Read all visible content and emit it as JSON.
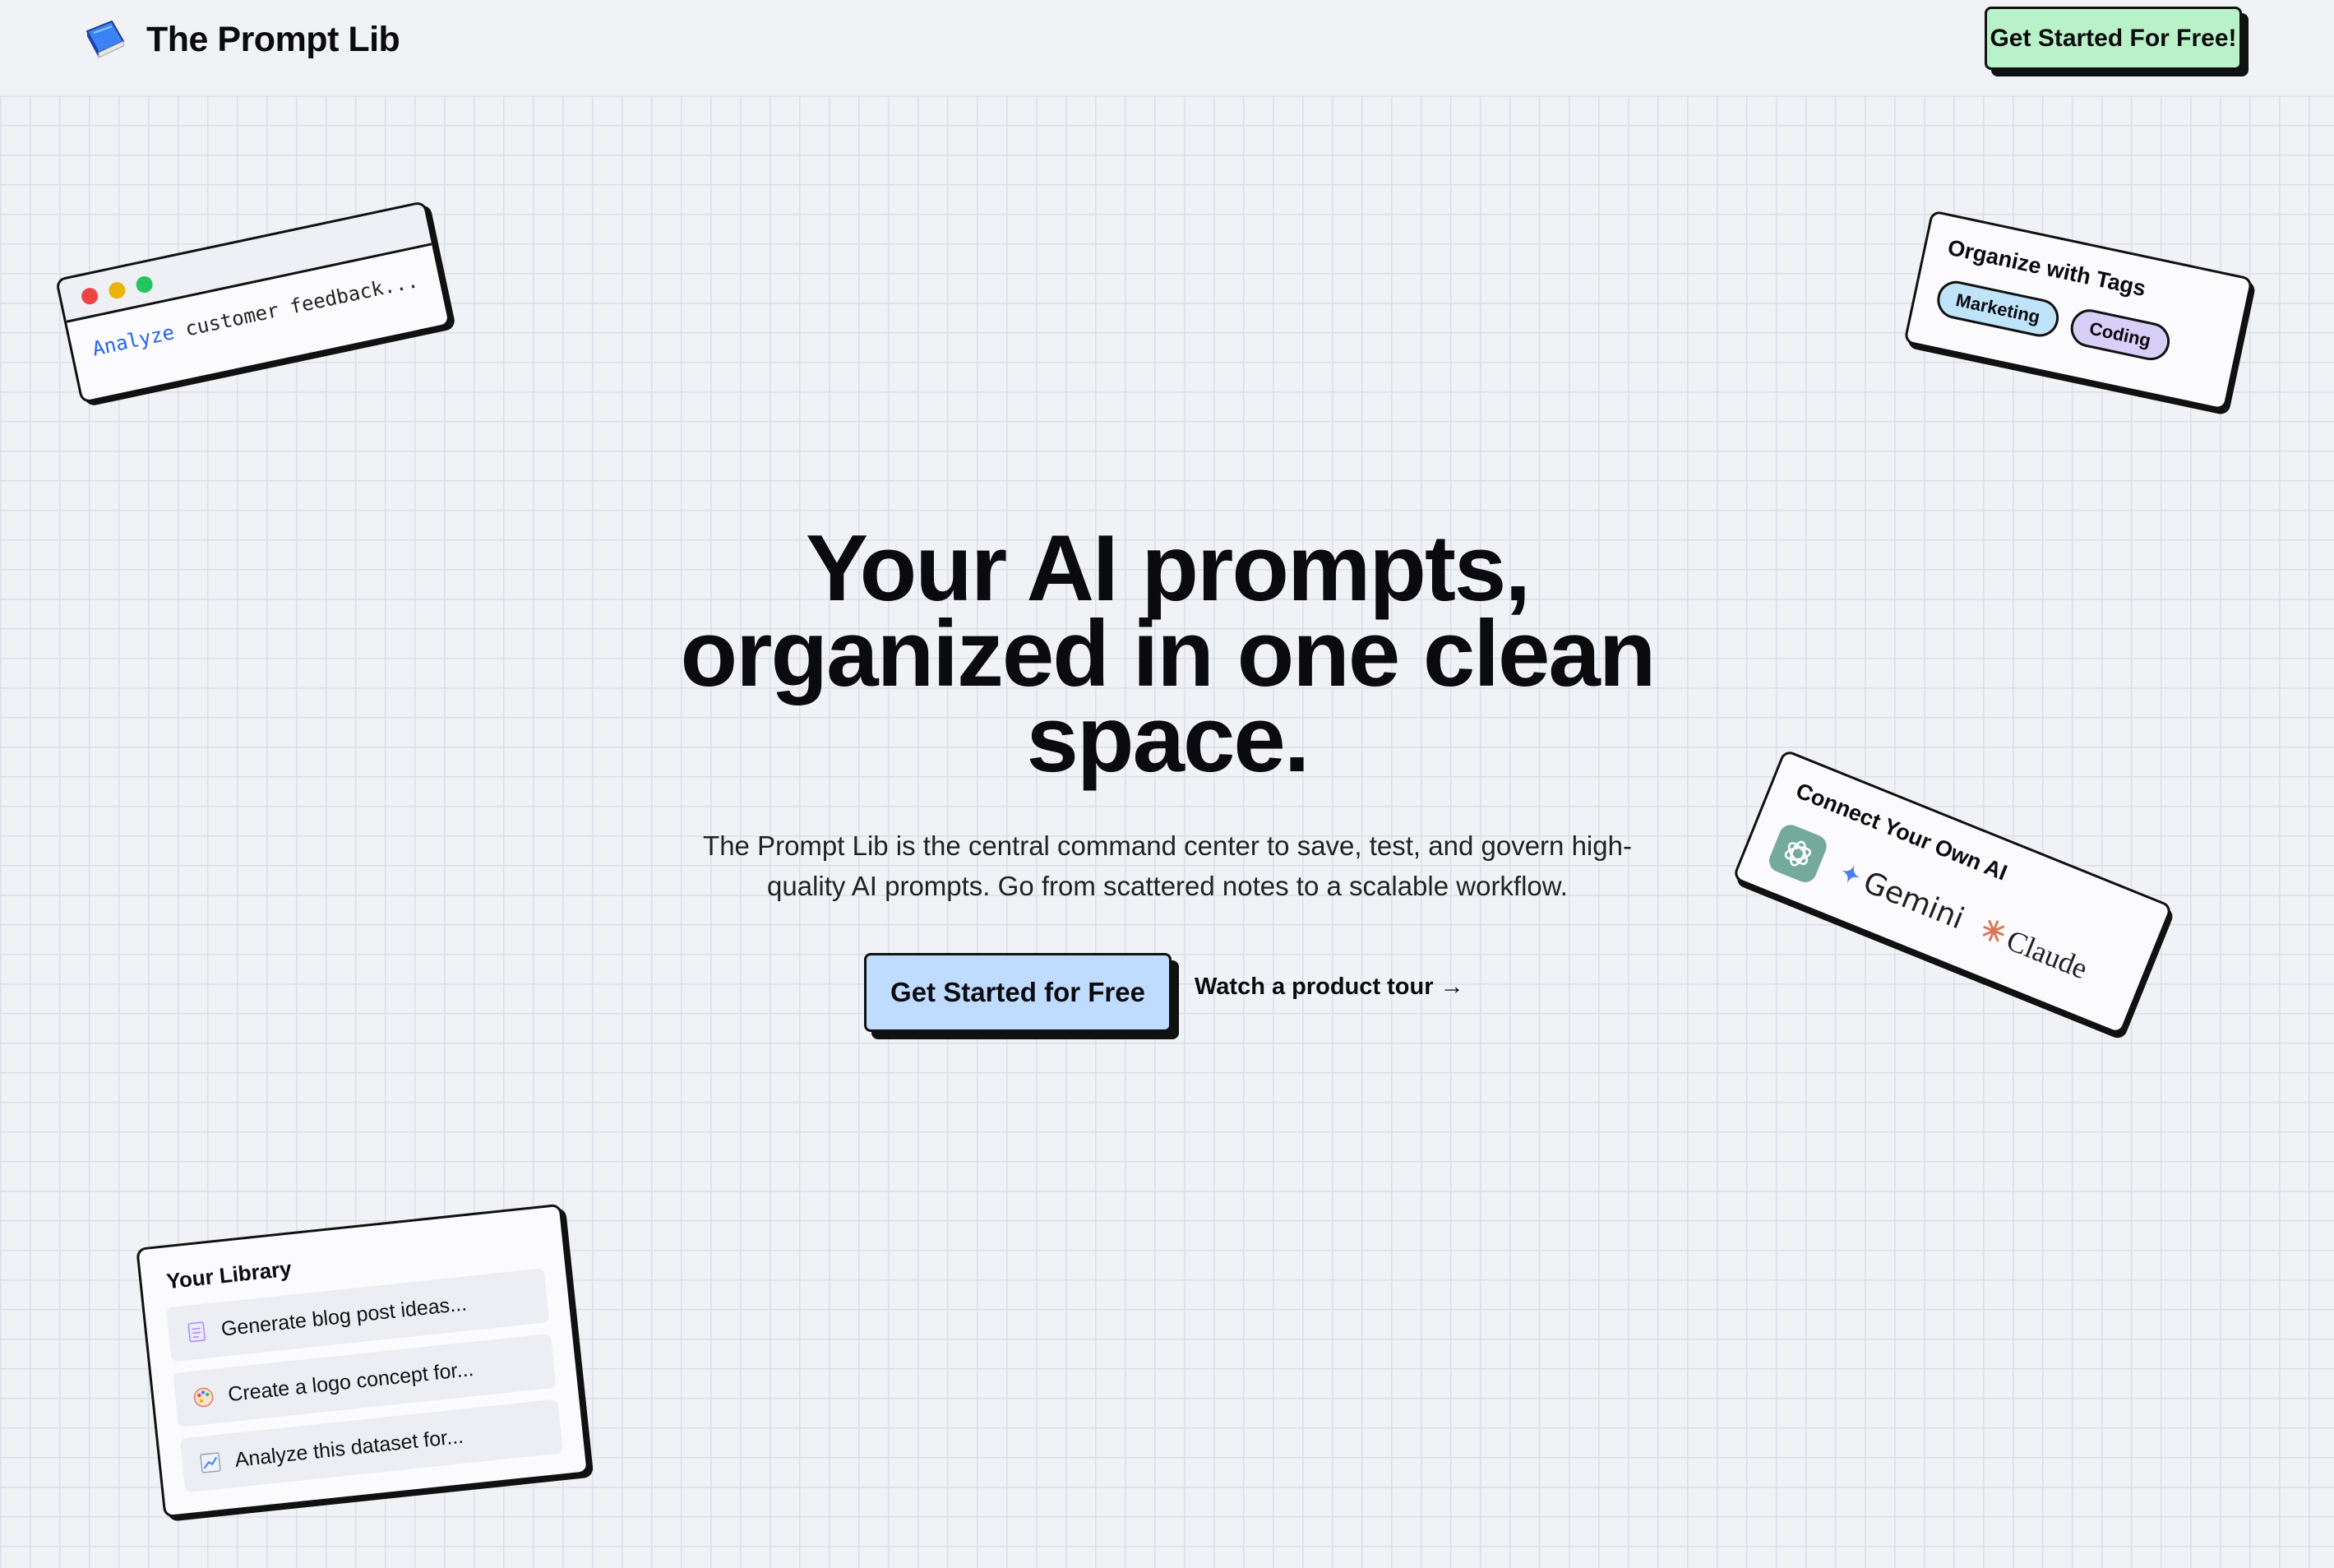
{
  "header": {
    "brand_title": "The Prompt Lib",
    "cta_label": "Get Started For Free!"
  },
  "hero": {
    "title": "Your AI prompts, organized in one clean space.",
    "subtitle": "The Prompt Lib is the central command center to save, test, and govern high-quality AI prompts. Go from scattered notes to a scalable workflow.",
    "primary_cta": "Get Started for Free",
    "secondary_cta": "Watch a product tour →"
  },
  "editor_card": {
    "keyword": "Analyze",
    "text": " customer feedback..."
  },
  "tags_card": {
    "title": "Organize with Tags",
    "tags": [
      "Marketing",
      "Coding"
    ]
  },
  "ai_card": {
    "title": "Connect Your Own AI",
    "providers": [
      "Gemini",
      "Claude"
    ]
  },
  "library_card": {
    "title": "Your Library",
    "items": [
      {
        "icon": "document-icon",
        "label": "Generate blog post ideas..."
      },
      {
        "icon": "palette-icon",
        "label": "Create a logo concept for..."
      },
      {
        "icon": "chart-icon",
        "label": "Analyze this dataset for..."
      }
    ]
  },
  "colors": {
    "background": "#f1f2f6",
    "header_cta": "#b9f2c9",
    "primary_cta": "#bfdbfe",
    "tag_marketing": "#bfe3f8",
    "tag_coding": "#d8cff9",
    "keyword": "#2563eb"
  }
}
